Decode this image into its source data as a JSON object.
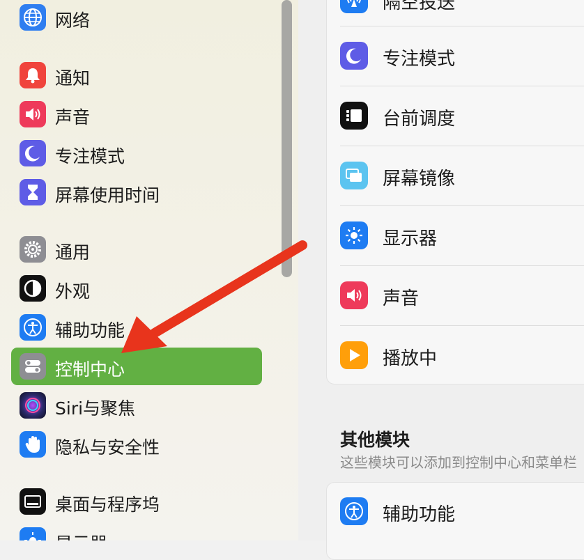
{
  "sidebar": {
    "items": [
      {
        "label": "网络",
        "icon": "globe-icon"
      },
      {
        "label": "通知",
        "icon": "bell-icon"
      },
      {
        "label": "声音",
        "icon": "speaker-icon"
      },
      {
        "label": "专注模式",
        "icon": "moon-icon"
      },
      {
        "label": "屏幕使用时间",
        "icon": "hourglass-icon"
      },
      {
        "label": "通用",
        "icon": "gear-icon"
      },
      {
        "label": "外观",
        "icon": "appearance-icon"
      },
      {
        "label": "辅助功能",
        "icon": "accessibility-icon"
      },
      {
        "label": "控制中心",
        "icon": "control-center-icon",
        "selected": true
      },
      {
        "label": "Siri与聚焦",
        "icon": "siri-icon"
      },
      {
        "label": "隐私与安全性",
        "icon": "hand-icon"
      },
      {
        "label": "桌面与程序坞",
        "icon": "dock-icon"
      },
      {
        "label": "显示器",
        "icon": "display-icon"
      }
    ]
  },
  "main": {
    "rows": [
      {
        "label": "隔空投送",
        "icon": "airdrop-icon"
      },
      {
        "label": "专注模式",
        "icon": "moon-icon"
      },
      {
        "label": "台前调度",
        "icon": "stage-manager-icon"
      },
      {
        "label": "屏幕镜像",
        "icon": "screen-mirroring-icon"
      },
      {
        "label": "显示器",
        "icon": "brightness-icon"
      },
      {
        "label": "声音",
        "icon": "speaker-icon"
      },
      {
        "label": "播放中",
        "icon": "play-icon"
      }
    ],
    "other_section": {
      "title": "其他模块",
      "subtitle": "这些模块可以添加到控制中心和菜单栏",
      "rows": [
        {
          "label": "辅助功能",
          "icon": "accessibility-icon"
        }
      ]
    }
  },
  "colors": {
    "selected_bg": "#62b043",
    "annotation_arrow": "#e8341c"
  }
}
